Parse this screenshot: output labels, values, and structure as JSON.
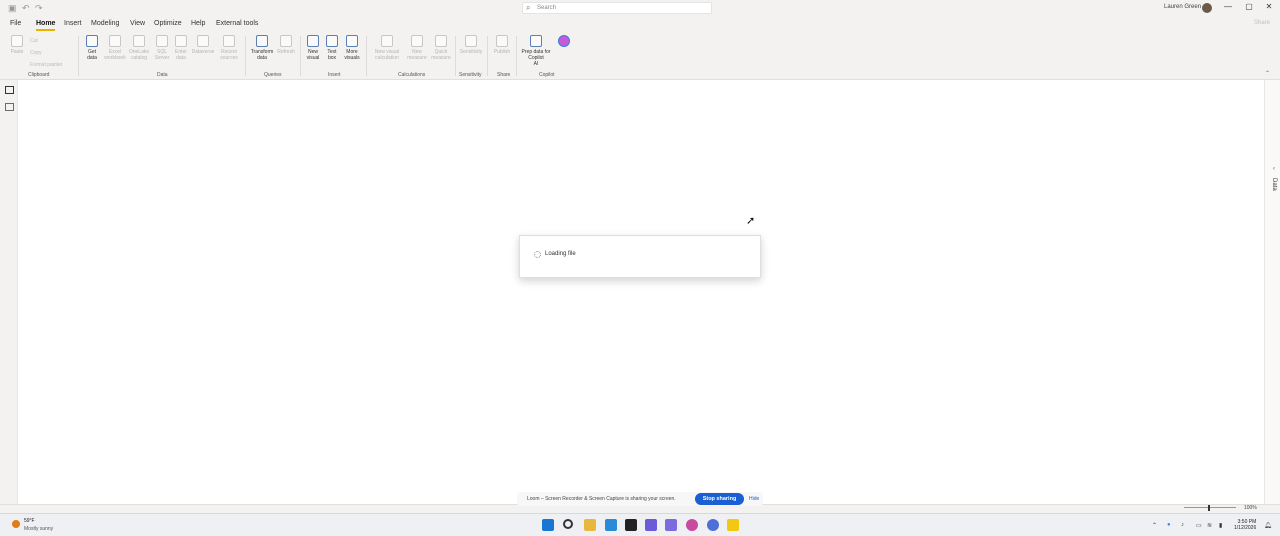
{
  "titlebar": {
    "search_placeholder": "Search",
    "user_name": "Lauren Green",
    "minimize": "—",
    "maximize": "▢",
    "close": "✕"
  },
  "menu": {
    "file": "File",
    "home": "Home",
    "insert": "Insert",
    "modeling": "Modeling",
    "view": "View",
    "optimize": "Optimize",
    "help": "Help",
    "external_tools": "External tools",
    "share": "Share"
  },
  "ribbon": {
    "paste": "Paste",
    "cut": "Cut",
    "copy": "Copy",
    "format_painter": "Format painter",
    "clipboard": "Clipboard",
    "get_data": "Get data",
    "excel_workbook": "Excel workbook",
    "onelake_catalog": "OneLake catalog",
    "sql_server": "SQL Server",
    "enter_data": "Enter data",
    "dataverse": "Dataverse",
    "recent_sources": "Recent sources",
    "data_group": "Data",
    "transform_data": "Transform data",
    "refresh": "Refresh",
    "queries_group": "Queries",
    "new_visual": "New visual",
    "text_box": "Text box",
    "more_visuals": "More visuals",
    "insert_group": "Insert",
    "new_visual_calculation": "New visual calculation",
    "new_measure": "New measure",
    "quick_measure": "Quick measure",
    "calculations_group": "Calculations",
    "sensitivity": "Sensitivity",
    "sensitivity_group": "Sensitivity",
    "publish": "Publish",
    "share_group": "Share",
    "prep_copilot": "Prep data for Copilot",
    "ai": "AI",
    "copilot_group": "Copilot"
  },
  "rightpane": {
    "data_tab": "Data"
  },
  "dialog": {
    "loading_text": "Loading file"
  },
  "loom": {
    "message": "Loom – Screen Recorder & Screen Capture is sharing your screen.",
    "stop_sharing": "Stop sharing",
    "hide": "Hide"
  },
  "statusbar": {
    "zoom": "100%"
  },
  "taskbar": {
    "temperature": "59°F",
    "condition": "Mostly sunny",
    "time": "3:50 PM",
    "date": "1/12/2026"
  }
}
